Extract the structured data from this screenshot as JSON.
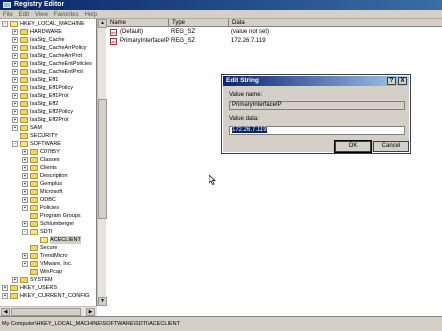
{
  "window": {
    "title": "Registry Editor"
  },
  "menu": [
    "File",
    "Edit",
    "View",
    "Favorites",
    "Help"
  ],
  "tree": [
    {
      "label": "HKEY_LOCAL_MACHINE",
      "level": 0,
      "exp": "-",
      "open": true
    },
    {
      "label": "HARDWARE",
      "level": 1,
      "exp": "+"
    },
    {
      "label": "IsaStg_Cache",
      "level": 1,
      "exp": "+"
    },
    {
      "label": "IsaStg_CacheArrPolicy",
      "level": 1,
      "exp": "+"
    },
    {
      "label": "IsaStg_CacheArrProt",
      "level": 1,
      "exp": "+"
    },
    {
      "label": "IsaStg_CacheEntPolicies",
      "level": 1,
      "exp": "+"
    },
    {
      "label": "IsaStg_CacheEntProt",
      "level": 1,
      "exp": "+"
    },
    {
      "label": "IsaStg_Eff1",
      "level": 1,
      "exp": "+"
    },
    {
      "label": "IsaStg_Eff1Policy",
      "level": 1,
      "exp": "+"
    },
    {
      "label": "IsaStg_Eff1Prot",
      "level": 1,
      "exp": "+"
    },
    {
      "label": "IsaStg_Eff2",
      "level": 1,
      "exp": "+"
    },
    {
      "label": "IsaStg_Eff2Policy",
      "level": 1,
      "exp": "+"
    },
    {
      "label": "IsaStg_Eff2Prot",
      "level": 1,
      "exp": "+"
    },
    {
      "label": "SAM",
      "level": 1,
      "exp": "+"
    },
    {
      "label": "SECURITY",
      "level": 1,
      "exp": ""
    },
    {
      "label": "SOFTWARE",
      "level": 1,
      "exp": "-",
      "open": true
    },
    {
      "label": "C07ft5Y",
      "level": 2,
      "exp": "+"
    },
    {
      "label": "Classes",
      "level": 2,
      "exp": "+"
    },
    {
      "label": "Clients",
      "level": 2,
      "exp": "+"
    },
    {
      "label": "Description",
      "level": 2,
      "exp": "+"
    },
    {
      "label": "Gemplus",
      "level": 2,
      "exp": "+"
    },
    {
      "label": "Microsoft",
      "level": 2,
      "exp": "+"
    },
    {
      "label": "ODBC",
      "level": 2,
      "exp": "+"
    },
    {
      "label": "Policies",
      "level": 2,
      "exp": "+"
    },
    {
      "label": "Program Groups",
      "level": 2,
      "exp": ""
    },
    {
      "label": "Schlumberger",
      "level": 2,
      "exp": "+"
    },
    {
      "label": "SDTI",
      "level": 2,
      "exp": "-",
      "open": true
    },
    {
      "label": "ACECLIENT",
      "level": 3,
      "exp": "",
      "open": true,
      "selected": true
    },
    {
      "label": "Secure",
      "level": 2,
      "exp": ""
    },
    {
      "label": "TrendMicro",
      "level": 2,
      "exp": "+"
    },
    {
      "label": "VMware, Inc.",
      "level": 2,
      "exp": "+"
    },
    {
      "label": "WinPcap",
      "level": 2,
      "exp": ""
    },
    {
      "label": "SYSTEM",
      "level": 1,
      "exp": "+"
    },
    {
      "label": "HKEY_USERS",
      "level": 0,
      "exp": "+"
    },
    {
      "label": "HKEY_CURRENT_CONFIG",
      "level": 0,
      "exp": "+"
    }
  ],
  "list": {
    "headers": {
      "name": "Name",
      "type": "Type",
      "data": "Data"
    },
    "rows": [
      {
        "name": "(Default)",
        "type": "REG_SZ",
        "data": "(value not set)"
      },
      {
        "name": "PrimaryInterfaceIP",
        "type": "REG_SZ",
        "data": "172.26.7.119"
      }
    ]
  },
  "status": "My Computer\\HKEY_LOCAL_MACHINE\\SOFTWARE\\SDTI\\ACECLIENT",
  "dialog": {
    "title": "Edit String",
    "help_label": "?",
    "close_label": "X",
    "value_name_label": "Value name:",
    "value_name": "PrimaryInterfaceIP",
    "value_data_label": "Value data:",
    "value_data": "172.26.7.119",
    "ok_label": "OK",
    "cancel_label": "Cancel"
  }
}
